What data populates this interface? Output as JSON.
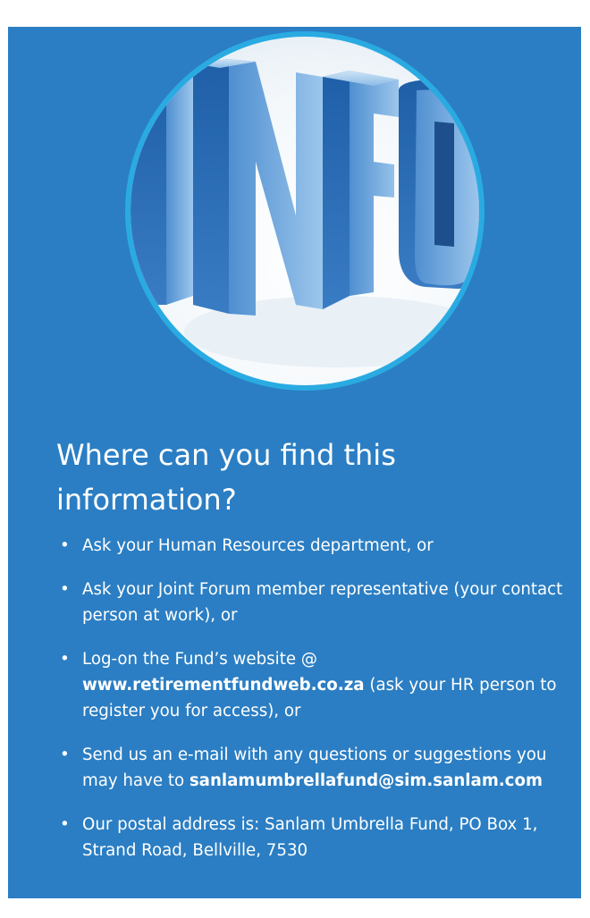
{
  "illustration": {
    "icon": "info-3d-letters-icon",
    "text": "INFO"
  },
  "heading": "Where can you find this information?",
  "items": [
    {
      "before": "Ask your Human Resources department, or",
      "link": "",
      "after": ""
    },
    {
      "before": "Ask your Joint Forum member representative (your contact person at work), or",
      "link": "",
      "after": ""
    },
    {
      "before": "Log-on the Fund’s website @ ",
      "link": "www.retirementfundweb.co.za",
      "after": " (ask your HR person to register you for access), or"
    },
    {
      "before": "Send us an e-mail with any questions or suggestions you may have to ",
      "link": "sanlamumbrellafund@sim.sanlam.com",
      "after": ""
    },
    {
      "before": "Our postal address is: Sanlam Umbrella Fund, PO Box 1, Strand Road, Bellville, 7530",
      "link": "",
      "after": ""
    }
  ],
  "colors": {
    "panel": "#2b7ec3",
    "ring": "#29abe2",
    "text": "#ffffff"
  }
}
